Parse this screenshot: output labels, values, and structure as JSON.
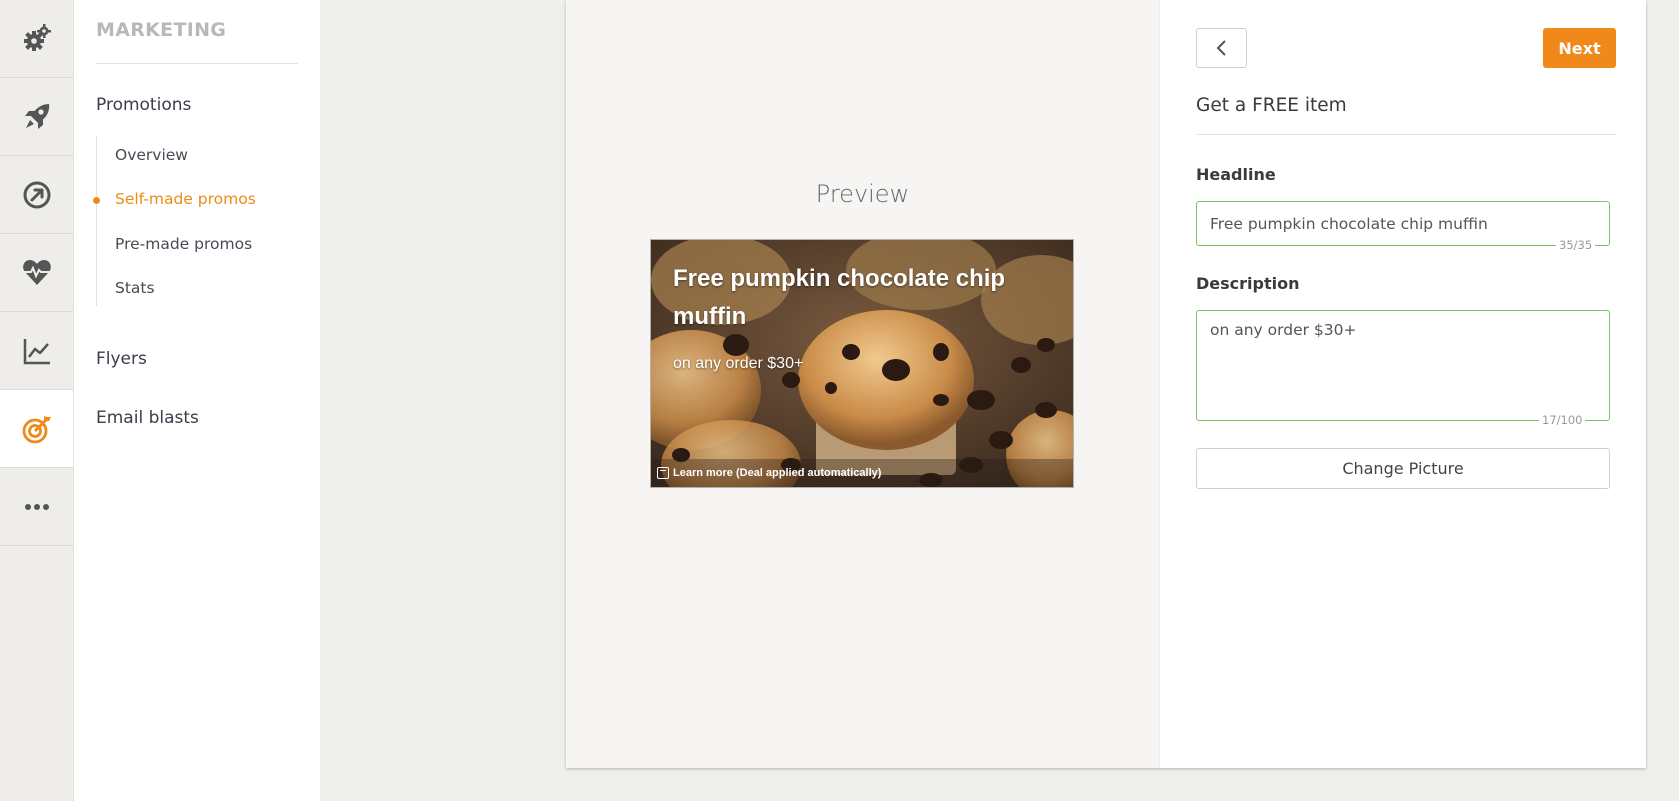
{
  "rail": {
    "items": [
      {
        "icon": "gears-icon",
        "active": false
      },
      {
        "icon": "rocket-icon",
        "active": false
      },
      {
        "icon": "gauge-icon",
        "active": false
      },
      {
        "icon": "heartbeat-icon",
        "active": false
      },
      {
        "icon": "line-chart-icon",
        "active": false
      },
      {
        "icon": "target-icon",
        "active": true
      },
      {
        "icon": "more-icon",
        "active": false
      }
    ]
  },
  "sidebar": {
    "section_title": "MARKETING",
    "promotions_label": "Promotions",
    "sub_items": [
      {
        "label": "Overview",
        "active": false
      },
      {
        "label": "Self-made promos",
        "active": true
      },
      {
        "label": "Pre-made promos",
        "active": false
      },
      {
        "label": "Stats",
        "active": false
      }
    ],
    "flyers_label": "Flyers",
    "email_blasts_label": "Email blasts"
  },
  "preview": {
    "label": "Preview",
    "headline": "Free pumpkin chocolate chip muffin",
    "description": "on any order $30+",
    "footer_text": "Learn more (Deal applied automatically)"
  },
  "form": {
    "next_label": "Next",
    "title": "Get a FREE item",
    "headline_label": "Headline",
    "headline_value": "Free pumpkin chocolate chip muffin",
    "headline_counter": "35/35",
    "description_label": "Description",
    "description_value": "on any order $30+",
    "description_counter": "17/100",
    "change_picture_label": "Change Picture"
  },
  "colors": {
    "accent": "#f08a17",
    "valid_border": "#7ac468"
  }
}
